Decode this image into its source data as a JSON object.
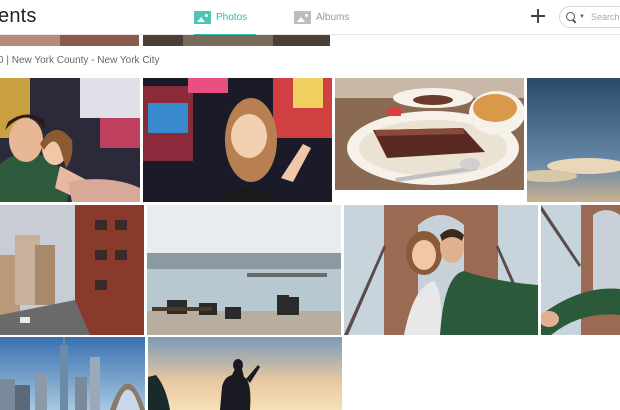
{
  "header": {
    "title": "ents",
    "tabs": [
      {
        "label": "Photos",
        "active": true
      },
      {
        "label": "Albums",
        "active": false
      }
    ],
    "search_placeholder": "Search"
  },
  "location": "0 | New York County - New York City",
  "icons": [
    "photos-tab-icon",
    "albums-tab-icon",
    "add-icon",
    "search-icon",
    "chevron-down-icon"
  ],
  "colors": {
    "accent": "#2eb8a8",
    "header_border": "#e6e6e6"
  }
}
